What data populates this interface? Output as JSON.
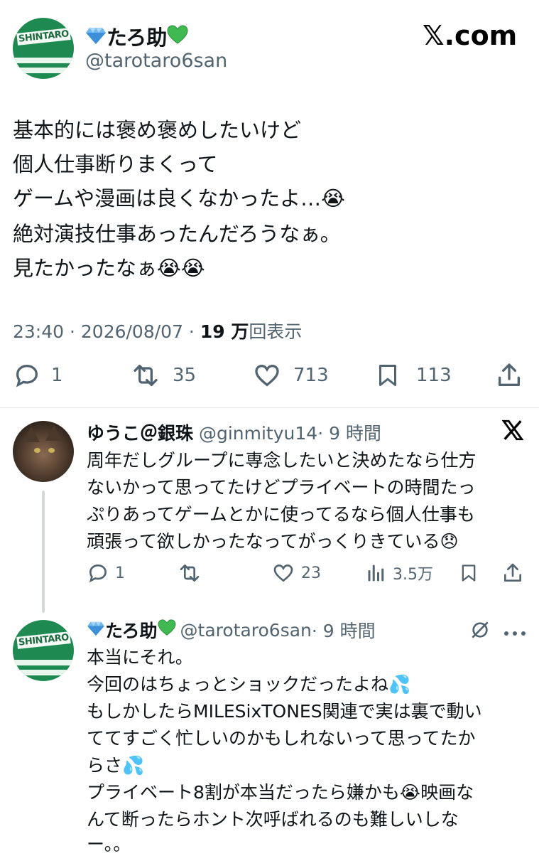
{
  "main_tweet": {
    "display_name": "たろ助",
    "handle": "@tarotaro6san",
    "brand": "𝕏.com",
    "avatar_text": "SHINTARO",
    "lines": [
      "基本的には褒め褒めしたいけど",
      "個人仕事断りまくって",
      "ゲームや漫画は良くなかったよ…😭",
      "絶対演技仕事あったんだろうなぁ。",
      "見たかったなぁ😭😭"
    ],
    "meta_time": "23:40 · 2026/08/07 · ",
    "meta_views_bold": "19 万",
    "meta_views_suffix": "回表示",
    "replies": "1",
    "retweets": "35",
    "likes": "713",
    "bookmarks": "113"
  },
  "reply1": {
    "display_name": "ゆうこ＠銀珠",
    "handle": "@ginmityu14",
    "time": "· 9 時間",
    "lines": [
      "周年だしグループに専念したいと決めたなら仕方",
      "ないかって思ってたけどプライベートの時間たっ",
      "ぷりあってゲームとかに使ってるなら個人仕事も",
      "頑張って欲しかったなってがっくりきている😞"
    ],
    "replies": "1",
    "likes": "23",
    "views": "3.5万"
  },
  "reply2": {
    "display_name": "たろ助",
    "handle": "@tarotaro6san",
    "time": "· 9 時間",
    "avatar_text": "SHINTARO",
    "lines": [
      "本当にそれ。",
      "今回のはちょっとショックだったよね💦",
      "もしかしたらMILESixTONES関連で実は裏で動い",
      "ててすごく忙しいのかもしれないって思ってたか",
      "らさ💦",
      "プライベート8割が本当だったら嫌かも😭映画な",
      "んて断ったらホント次呼ばれるのも難しいしな",
      "ー。。"
    ]
  },
  "colors": {
    "text": "#0f1419",
    "muted": "#536471",
    "line": "#cfd9de",
    "shintaro_green": "#1e8a52"
  }
}
